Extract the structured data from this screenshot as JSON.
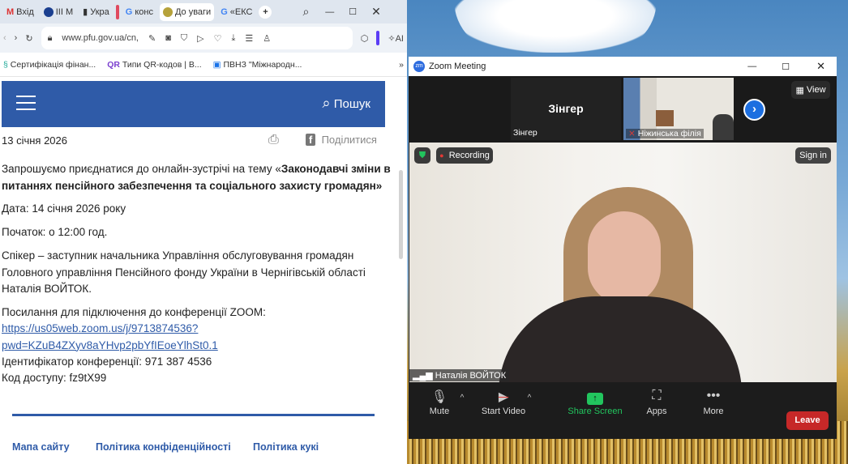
{
  "browser": {
    "tabs": [
      {
        "label": "Вхід",
        "icon": "gmail-icon"
      },
      {
        "label": "III M",
        "icon": "eu-icon"
      },
      {
        "label": "Укра",
        "icon": "doc-icon"
      },
      {
        "label": "конс",
        "icon": "google-icon"
      },
      {
        "label": "До уваги",
        "icon": "pfu-icon",
        "active": true
      },
      {
        "label": "«ЕКС",
        "icon": "google-icon"
      }
    ],
    "url": "www.pfu.gov.ua/cn,",
    "ai_label": "AI",
    "bookmarks": [
      "Сертифікація фінан...",
      "Типи QR-кодов | В...",
      "ПВНЗ \"Міжнародн..."
    ],
    "accent": "#2f5ba8"
  },
  "page": {
    "search_label": "Пошук",
    "date": "13 січня 2026",
    "share_label": "Поділитися",
    "intro": "Запрошуємо приєднатися до онлайн-зустрічі на тему «",
    "topic": "Законодавчі зміни в питаннях пенсійного забезпечення та соціального захисту громадян",
    "intro_end": "»",
    "event_date": "Дата: 14 січня 2026 року",
    "start": "Початок: о 12:00 год.",
    "speaker_1": "Спікер – заступник начальника Управління обслуговування громадян",
    "speaker_2": "Головного управління Пенсійного фонду України в Чернігівській області",
    "speaker_3": "Наталія ВОЙТОК.",
    "link_label": "Посилання для підключення до конференції ZOOM:",
    "link_1": "https://us05web.zoom.us/j/9713874536?",
    "link_2": "pwd=KZuB4ZXyv8aYHvp2pbYfIEoeYlhSt0.1",
    "meeting_id": "Ідентифікатор конференції: 971 387 4536",
    "passcode": "Код доступу: fz9tX99",
    "footer": [
      "Мапа сайту",
      "Політика конфіденційності",
      "Політика кукі"
    ]
  },
  "zoom": {
    "title": "Zoom Meeting",
    "tile_1_name": "Зінгер",
    "tile_1_label": "Зінгер",
    "tile_2_label": "Ніжинська філія",
    "view_label": "View",
    "recording_label": "Recording",
    "sign_in": "Sign in",
    "speaker_name": "Наталія ВОЙТОК",
    "toolbar": {
      "mute": "Mute",
      "start_video": "Start Video",
      "share_screen": "Share Screen",
      "apps": "Apps",
      "more": "More",
      "leave": "Leave"
    },
    "colors": {
      "share": "#22c55e",
      "leave": "#c62828",
      "recording": "#e53935"
    }
  }
}
